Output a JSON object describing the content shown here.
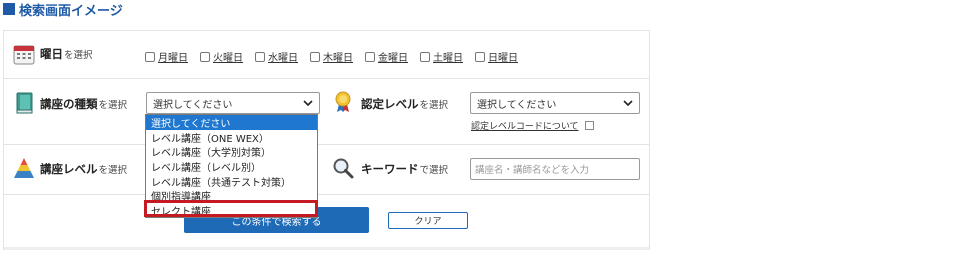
{
  "heading": {
    "title": "検索画面イメージ"
  },
  "rows": {
    "day": {
      "label_strong": "曜日",
      "label_small": "を選択",
      "days": [
        "月曜日",
        "火曜日",
        "水曜日",
        "木曜日",
        "金曜日",
        "土曜日",
        "日曜日"
      ]
    },
    "course_type": {
      "label_strong": "講座の種類",
      "label_small": "を選択",
      "select_value": "選択してください"
    },
    "cert_level": {
      "label_strong": "認定レベル",
      "label_small": "を選択",
      "select_value": "選択してください",
      "link_text": "認定レベルコードについて"
    },
    "course_level": {
      "label_strong": "講座レベル",
      "label_small": "を選択"
    },
    "keyword": {
      "label_strong": "キーワード",
      "label_small": "で選択",
      "placeholder": "講座名・講師名などを入力"
    }
  },
  "dropdown": {
    "options": [
      "選択してください",
      "レベル講座（ONE WEX）",
      "レベル講座（大学別対策）",
      "レベル講座（レベル別）",
      "レベル講座（共通テスト対策）",
      "個別指導講座",
      "セレクト講座"
    ],
    "selected_index": 0,
    "highlighted_index": 6
  },
  "buttons": {
    "search": "この条件で検索する",
    "clear": "クリア"
  },
  "colors": {
    "accent": "#1f5aa6",
    "button_blue": "#1f6ab7",
    "dropdown_selected": "#1f77d0",
    "highlight_red": "#c61a23"
  },
  "icons": {
    "day": "calendar-icon",
    "course_type": "book-icon",
    "cert_level": "medal-icon",
    "course_level": "pyramid-icon",
    "keyword": "magnifier-icon",
    "chevron": "chevron-down-icon",
    "external": "external-link-icon"
  }
}
